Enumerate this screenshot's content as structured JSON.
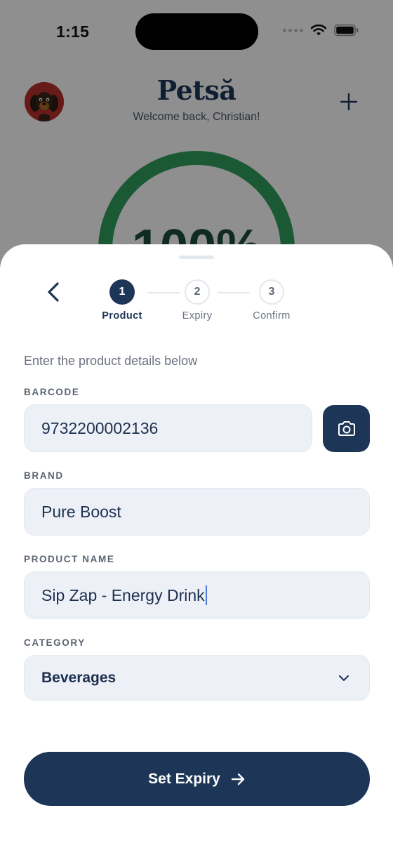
{
  "status_bar": {
    "time": "1:15"
  },
  "app": {
    "logo_text": "Petsă",
    "welcome": "Welcome back, Christian!",
    "progress_percent_text": "100%"
  },
  "sheet": {
    "steps": [
      {
        "number": "1",
        "label": "Product",
        "state": "active"
      },
      {
        "number": "2",
        "label": "Expiry",
        "state": "pending"
      },
      {
        "number": "3",
        "label": "Confirm",
        "state": "pending"
      }
    ],
    "intro": "Enter the product details below",
    "fields": {
      "barcode": {
        "label": "BARCODE",
        "value": "9732200002136"
      },
      "brand": {
        "label": "BRAND",
        "value": "Pure Boost"
      },
      "product_name": {
        "label": "PRODUCT NAME",
        "value": "Sip Zap - Energy Drink"
      },
      "category": {
        "label": "CATEGORY",
        "value": "Beverages"
      }
    },
    "cta_label": "Set Expiry"
  },
  "colors": {
    "primary": "#1d3557",
    "progress_green": "#2f9a5a",
    "field_bg": "#edf1f7",
    "avatar_bg": "#b2302c"
  },
  "icons": [
    "back-chevron-icon",
    "camera-icon",
    "chevron-down-icon",
    "arrow-right-icon",
    "plus-icon",
    "wifi-icon",
    "battery-icon"
  ]
}
